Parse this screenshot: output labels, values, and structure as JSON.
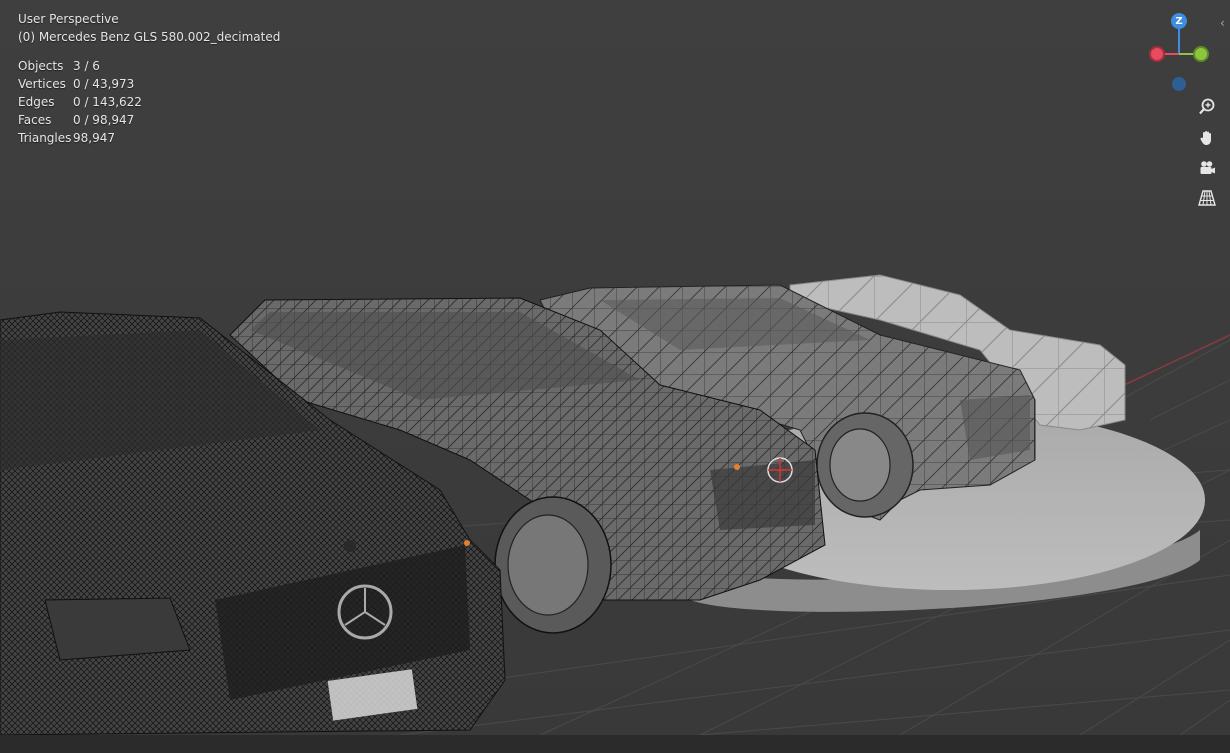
{
  "viewport": {
    "view_name": "User Perspective",
    "active_object": "(0) Mercedes Benz GLS 580.002_decimated",
    "stats": [
      {
        "label": "Objects",
        "value": "3 / 6"
      },
      {
        "label": "Vertices",
        "value": "0 / 43,973"
      },
      {
        "label": "Edges",
        "value": "0 / 143,622"
      },
      {
        "label": "Faces",
        "value": "0 / 98,947"
      },
      {
        "label": "Triangles",
        "value": "98,947"
      }
    ]
  },
  "gizmo": {
    "z_label": "Z",
    "colors": {
      "x": "#e84a5f",
      "y": "#8cc63f",
      "z": "#3d8ee0"
    }
  },
  "nav_buttons": [
    {
      "icon": "zoom-icon"
    },
    {
      "icon": "hand-pan-icon"
    },
    {
      "icon": "camera-icon"
    },
    {
      "icon": "grid-perspective-icon"
    }
  ],
  "colors": {
    "viewport_bg": "#3d3d3d",
    "grid_line": "#4a4a4a",
    "platform": "#b8b8b8"
  }
}
